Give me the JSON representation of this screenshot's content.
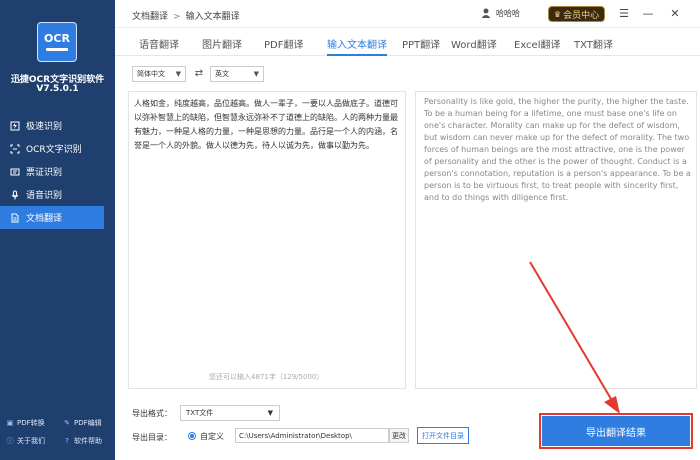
{
  "sidebar": {
    "logo_text": "OCR",
    "app_name": "迅捷OCR文字识别软件",
    "version": "V7.5.0.1",
    "items": [
      {
        "label": "极速识别",
        "icon": "lightning-icon"
      },
      {
        "label": "OCR文字识别",
        "icon": "ocr-icon"
      },
      {
        "label": "票证识别",
        "icon": "ticket-icon"
      },
      {
        "label": "语音识别",
        "icon": "microphone-icon"
      },
      {
        "label": "文档翻译",
        "icon": "document-icon"
      }
    ],
    "active_index": 4,
    "bottom_links": [
      {
        "label": "PDF转换",
        "icon": "pdf-convert-icon"
      },
      {
        "label": "PDF编辑",
        "icon": "pdf-edit-icon"
      },
      {
        "label": "关于我们",
        "icon": "info-icon"
      },
      {
        "label": "软件帮助",
        "icon": "help-icon"
      }
    ]
  },
  "titlebar": {
    "breadcrumb": [
      "文档翻译",
      "输入文本翻译"
    ],
    "username": "哈哈哈",
    "vip_label": "会员中心"
  },
  "tabs": [
    {
      "label": "语音翻译"
    },
    {
      "label": "图片翻译"
    },
    {
      "label": "PDF翻译"
    },
    {
      "label": "输入文本翻译"
    },
    {
      "label": "PPT翻译"
    },
    {
      "label": "Word翻译"
    },
    {
      "label": "Excel翻译"
    },
    {
      "label": "TXT翻译"
    }
  ],
  "active_tab": 3,
  "language": {
    "source": "简体中文",
    "target": "英文"
  },
  "source_text": "人格如金，纯度越高，品位越高。做人一辈子，一要以人品做底子。道德可以弥补智慧上的缺陷，但智慧永远弥补不了道德上的缺陷。人的两种力量最有魅力，一种是人格的力量，一种是思想的力量。品行是一个人的内涵，名誉是一个人的外貌。做人以德为先，待人以诚为先，做事以勤为先。",
  "char_counter": "您还可以输入4871字（129/5000）",
  "translated_text": "Personality is like gold, the higher the purity, the higher the taste. To be a human being for a lifetime, one must base one's life on one's character. Morality can make up for the defect of wisdom, but wisdom can never make up for the defect of morality. The two forces of human beings are the most attractive, one is the power of personality and the other is the power of thought. Conduct is a person's connotation, reputation is a person's appearance. To be a person is to be virtuous first, to treat people with sincerity first, and to do things with diligence first.",
  "export": {
    "format_label": "导出格式：",
    "format_value": "TXT文件",
    "dir_label": "导出目录：",
    "custom_label": "自定义",
    "path": "C:\\Users\\Administrator\\Desktop\\",
    "change_label": "更改",
    "open_dir_label": "打开文件目录",
    "export_button": "导出翻译结果"
  },
  "colors": {
    "sidebar_bg": "#1f3f6e",
    "accent": "#2f7de1",
    "annotation_red": "#e23a2e"
  }
}
